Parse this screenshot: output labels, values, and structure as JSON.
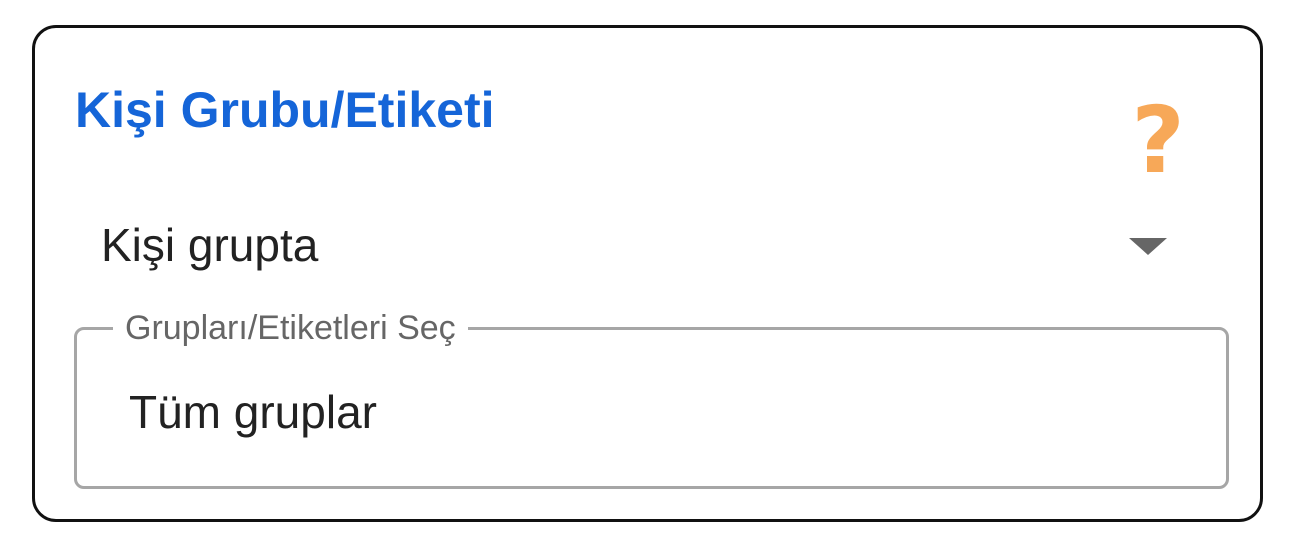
{
  "panel": {
    "title": "Kişi Grubu/Etiketi",
    "help_icon": "question-mark-icon",
    "help_glyph": "?",
    "accent_color": "#1565d8",
    "help_color": "#f7a858"
  },
  "condition_select": {
    "selected": "Kişi grupta",
    "caret_icon": "caret-down-icon"
  },
  "groups_field": {
    "label": "Grupları/Etiketleri Seç",
    "value": "Tüm gruplar"
  }
}
